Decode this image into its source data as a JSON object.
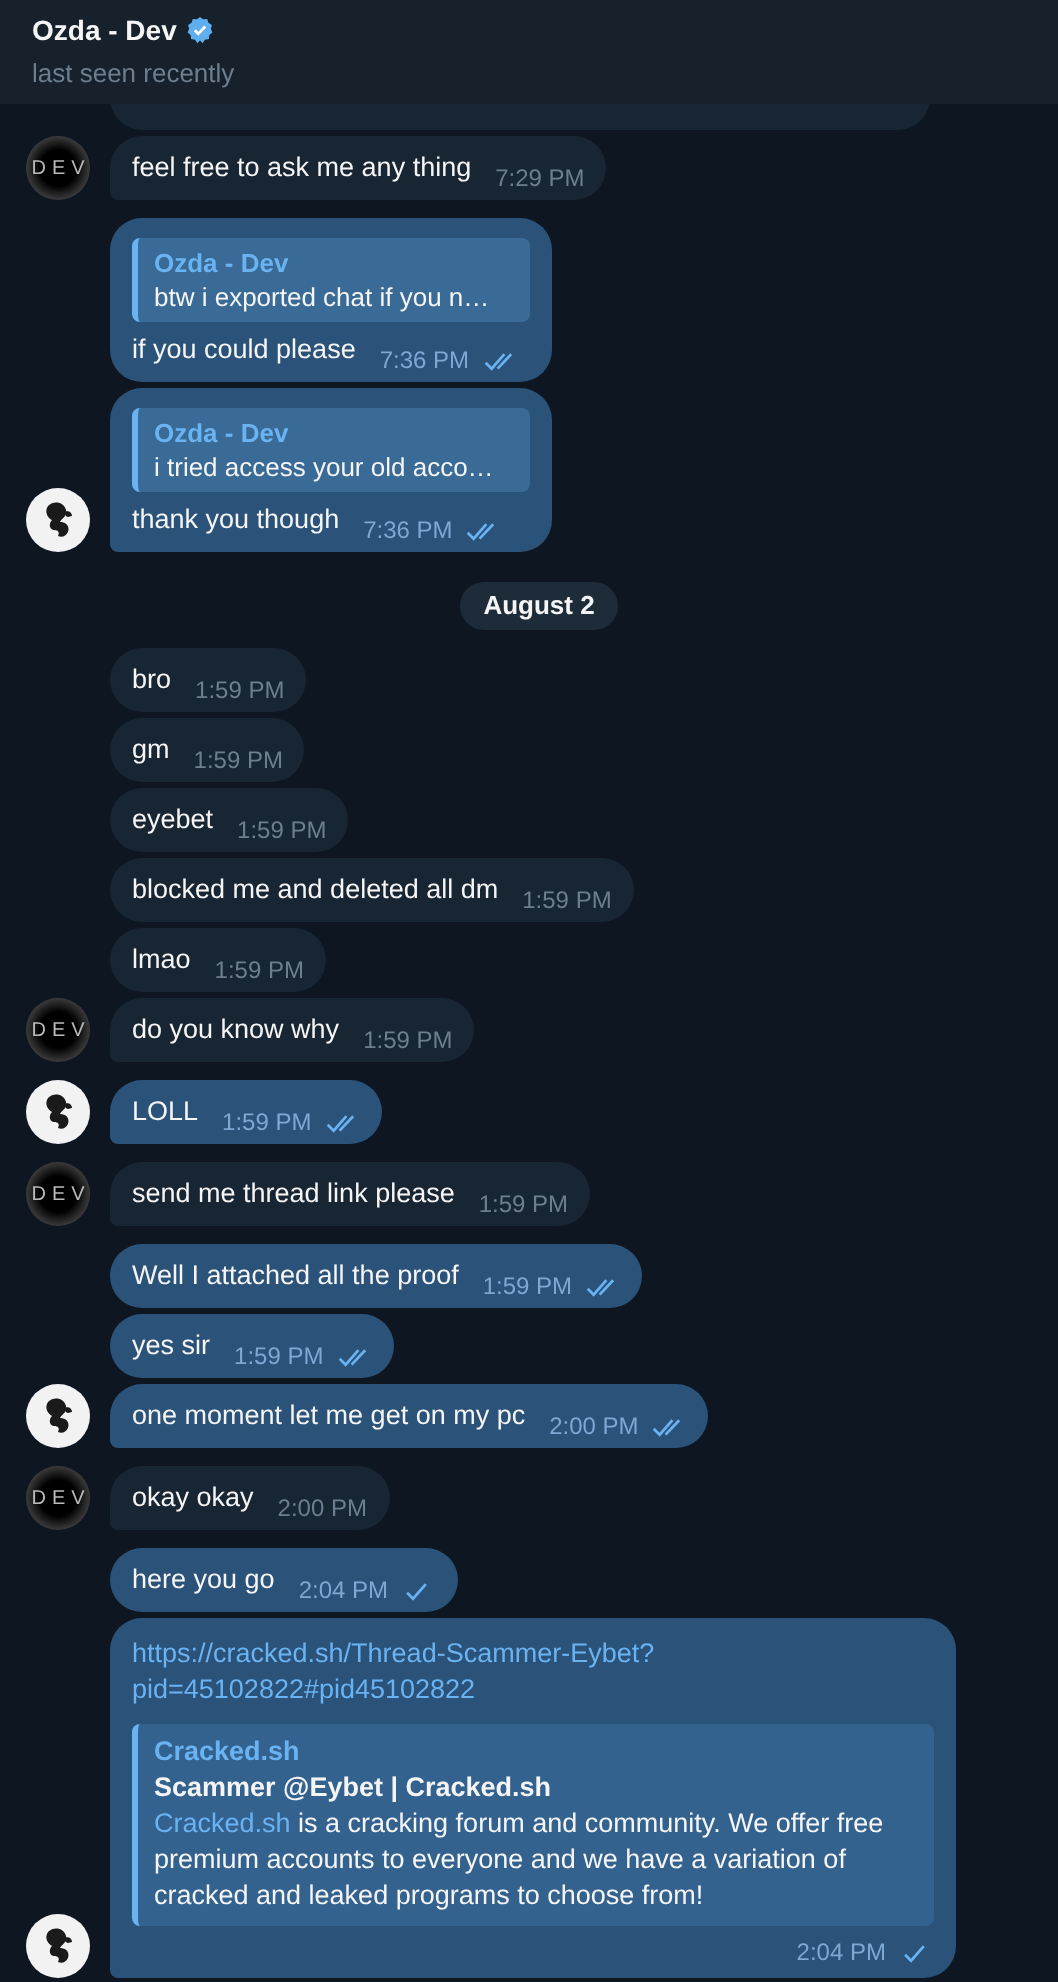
{
  "header": {
    "title": "Ozda - Dev",
    "verified": true,
    "status": "last seen recently"
  },
  "messages": [
    {
      "kind": "partial",
      "outgoing": false
    },
    {
      "kind": "message",
      "outgoing": false,
      "text": "feel free to ask me any thing",
      "time": "7:29 PM",
      "avatar": {
        "kind": "letters",
        "text": "DEV"
      }
    },
    {
      "kind": "gap"
    },
    {
      "kind": "message",
      "outgoing": true,
      "reply": {
        "name": "Ozda - Dev",
        "text": "btw i exported chat if you n…"
      },
      "text": "if you could please",
      "time": "7:36 PM",
      "read": true
    },
    {
      "kind": "message",
      "outgoing": true,
      "reply": {
        "name": "Ozda - Dev",
        "text": "i tried access your old acco…"
      },
      "text": "thank you though",
      "time": "7:36 PM",
      "read": true
    },
    {
      "kind": "date",
      "text": "August 2"
    },
    {
      "kind": "message",
      "outgoing": false,
      "text": "bro",
      "time": "1:59 PM"
    },
    {
      "kind": "message",
      "outgoing": false,
      "text": "gm",
      "time": "1:59 PM"
    },
    {
      "kind": "message",
      "outgoing": false,
      "text": "eyebet",
      "time": "1:59 PM"
    },
    {
      "kind": "message",
      "outgoing": false,
      "text": "blocked me and deleted all dm",
      "time": "1:59 PM"
    },
    {
      "kind": "message",
      "outgoing": false,
      "text": "lmao",
      "time": "1:59 PM"
    },
    {
      "kind": "message",
      "outgoing": false,
      "text": "do you know why",
      "time": "1:59 PM",
      "avatar": {
        "kind": "letters",
        "text": "DEV"
      }
    },
    {
      "kind": "gap"
    },
    {
      "kind": "message",
      "outgoing": true,
      "text": "LOLL",
      "time": "1:59 PM",
      "read": true
    },
    {
      "kind": "gap"
    },
    {
      "kind": "message",
      "outgoing": false,
      "text": "send me thread link please",
      "time": "1:59 PM",
      "avatar": {
        "kind": "letters",
        "text": "DEV"
      }
    },
    {
      "kind": "gap"
    },
    {
      "kind": "message",
      "outgoing": true,
      "text": "Well I attached all the proof",
      "time": "1:59 PM",
      "read": true
    },
    {
      "kind": "message",
      "outgoing": true,
      "text": "yes sir",
      "time": "1:59 PM",
      "read": true
    },
    {
      "kind": "message",
      "outgoing": true,
      "text": "one moment let me get on my pc",
      "time": "2:00 PM",
      "read": true
    },
    {
      "kind": "gap"
    },
    {
      "kind": "message",
      "outgoing": false,
      "text": "okay okay",
      "time": "2:00 PM",
      "avatar": {
        "kind": "letters",
        "text": "DEV"
      }
    },
    {
      "kind": "gap"
    },
    {
      "kind": "message",
      "outgoing": true,
      "text": "here you go",
      "time": "2:04 PM",
      "read": false
    },
    {
      "kind": "message",
      "outgoing": true,
      "link": "https://cracked.sh/Thread-Scammer-Eybet?pid=45102822#pid45102822",
      "preview": {
        "site": "Cracked.sh",
        "title": "Scammer @Eybet | Cracked.sh",
        "desc_link": "Cracked.sh",
        "desc": " is a cracking forum and community. We offer free premium accounts to everyone and we have a variation of cracked and leaked programs to choose from!"
      },
      "time": "2:04 PM",
      "read": false
    }
  ]
}
